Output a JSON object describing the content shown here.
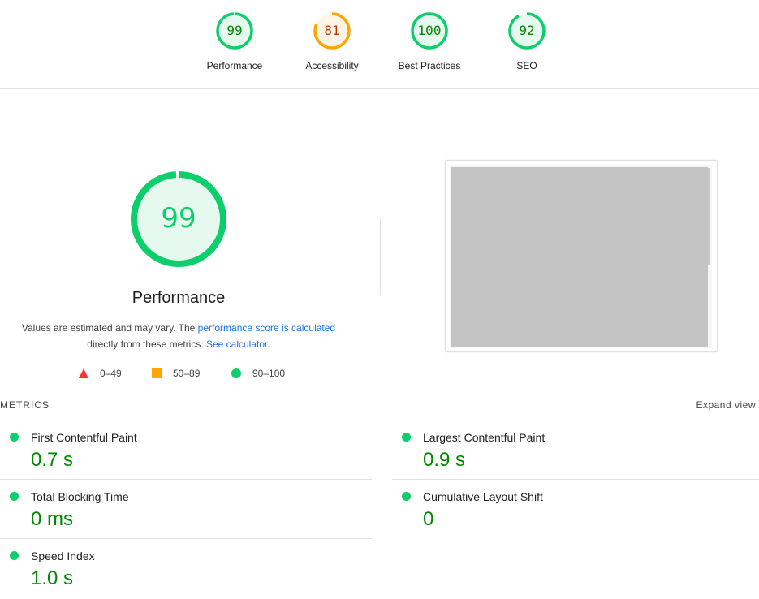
{
  "colors": {
    "pass": "#0cce6b",
    "pass_text": "#008800",
    "average": "#ffa400",
    "average_text": "#c33300",
    "fail": "#ff3333",
    "link": "#1a73e8"
  },
  "category_gauges": [
    {
      "label": "Performance",
      "score": "99",
      "value": 0.99,
      "rating": "pass"
    },
    {
      "label": "Accessibility",
      "score": "81",
      "value": 0.81,
      "rating": "average"
    },
    {
      "label": "Best Practices",
      "score": "100",
      "value": 1.0,
      "rating": "pass"
    },
    {
      "label": "SEO",
      "score": "92",
      "value": 0.92,
      "rating": "pass"
    }
  ],
  "performance": {
    "score": "99",
    "value": 0.99,
    "title": "Performance",
    "desc_prefix": "Values are estimated and may vary. The ",
    "desc_link1": "performance score is calculated",
    "desc_middle": " directly from these metrics. ",
    "desc_link2": "See calculator",
    "desc_suffix": "."
  },
  "legend": [
    {
      "icon": "triangle-icon",
      "range": "0–49"
    },
    {
      "icon": "square-icon",
      "range": "50–89"
    },
    {
      "icon": "circle-icon",
      "range": "90–100"
    }
  ],
  "metrics_section": {
    "header": "METRICS",
    "expand_label": "Expand view"
  },
  "metrics": [
    {
      "name": "First Contentful Paint",
      "value": "0.7 s"
    },
    {
      "name": "Largest Contentful Paint",
      "value": "0.9 s"
    },
    {
      "name": "Total Blocking Time",
      "value": "0 ms"
    },
    {
      "name": "Cumulative Layout Shift",
      "value": "0"
    },
    {
      "name": "Speed Index",
      "value": "1.0 s"
    }
  ]
}
